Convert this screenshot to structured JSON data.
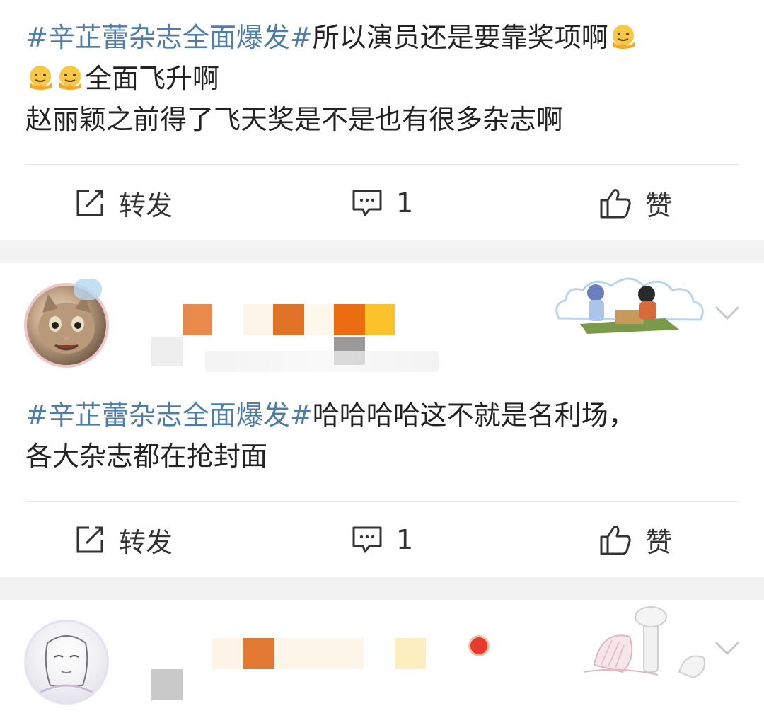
{
  "posts": [
    {
      "text_parts": {
        "topic": "#辛芷蕾杂志全面爆发#",
        "line1": "所以演员还是要靠奖项啊",
        "line2": "全面飞升啊",
        "line3": "赵丽颖之前得了飞天奖是不是也有很多杂志啊"
      },
      "emojis": [
        "melting-face-emoji",
        "melting-face-emoji",
        "melting-face-emoji"
      ],
      "actions": {
        "repost_label": "转发",
        "comment_count": "1",
        "like_label": "赞"
      }
    },
    {
      "user": {
        "avatar": "cat-avatar",
        "name_hidden": true,
        "meta_hidden": true
      },
      "text_parts": {
        "topic": "#辛芷蕾杂志全面爆发#",
        "line1": "哈哈哈哈这不就是名利场，",
        "line2": "各大杂志都在抢封面"
      },
      "actions": {
        "repost_label": "转发",
        "comment_count": "1",
        "like_label": "赞"
      }
    },
    {
      "user": {
        "avatar": "anime-sketch-avatar",
        "name_hidden": true,
        "verified_icon": "weibo-icon"
      }
    }
  ],
  "icons": {
    "repost": "repost-icon",
    "comment": "comment-icon",
    "like": "thumbs-up-icon",
    "more": "chevron-down-icon"
  },
  "colors": {
    "topic": "#4f7da9",
    "text": "#222222",
    "background": "#f2f2f2",
    "card": "#ffffff",
    "icon": "#333333"
  }
}
